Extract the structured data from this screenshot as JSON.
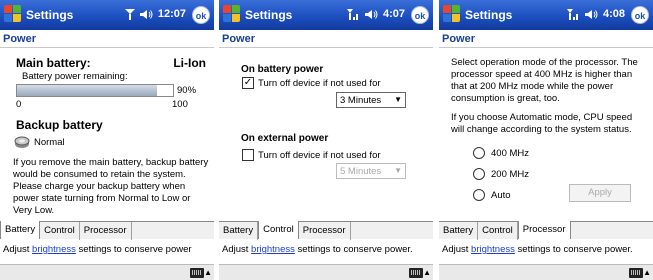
{
  "screens": [
    {
      "title": "Settings",
      "time": "12:07",
      "ok": "ok",
      "page": "Power",
      "main_battery_label": "Main battery:",
      "main_battery_type": "Li-Ion",
      "remaining_label": "Battery power remaining:",
      "remaining_percent": 90,
      "remaining_text": "90%",
      "scale_min": "0",
      "scale_max": "100",
      "backup_label": "Backup battery",
      "backup_state": "Normal",
      "paragraph": "If you remove the main battery, backup battery would be consumed to retain the system. Please charge your backup battery when power state turning from Normal to Low or Very Low.",
      "tabs": [
        "Battery",
        "Control",
        "Processor"
      ],
      "active_tab": 0,
      "hint_prefix": "Adjust ",
      "hint_link": "brightness",
      "hint_suffix": " settings to conserve power"
    },
    {
      "title": "Settings",
      "time": "4:07",
      "ok": "ok",
      "page": "Power",
      "battery_section": "On battery power",
      "battery_checkbox": "Turn off device if not used for",
      "battery_checked": true,
      "battery_timeout": "3 Minutes",
      "external_section": "On external power",
      "external_checkbox": "Turn off device if not used for",
      "external_checked": false,
      "external_timeout": "5 Minutes",
      "tabs": [
        "Battery",
        "Control",
        "Processor"
      ],
      "active_tab": 1,
      "hint_prefix": "Adjust ",
      "hint_link": "brightness",
      "hint_suffix": " settings to conserve power."
    },
    {
      "title": "Settings",
      "time": "4:08",
      "ok": "ok",
      "page": "Power",
      "paragraph1": "Select operation mode of the processor. The processor speed at 400 MHz is higher than that at 200 MHz mode while the power consumption is great, too.",
      "paragraph2": "If you choose Automatic mode, CPU speed will change according to the system status.",
      "options": [
        "400 MHz",
        "200 MHz",
        "Auto"
      ],
      "apply": "Apply",
      "tabs": [
        "Battery",
        "Control",
        "Processor"
      ],
      "active_tab": 2,
      "hint_prefix": "Adjust ",
      "hint_link": "brightness",
      "hint_suffix": " settings to conserve power."
    }
  ]
}
